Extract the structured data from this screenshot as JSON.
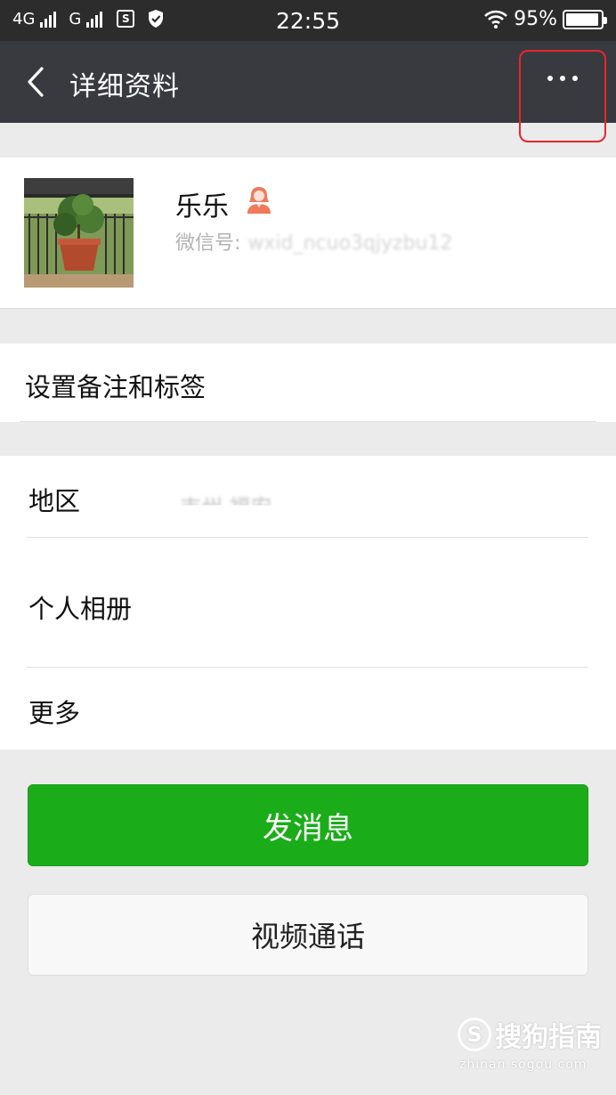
{
  "status_bar": {
    "network_1": "4G",
    "network_2": "G",
    "sim_icon_text": "S",
    "time": "22:55",
    "battery": "95%",
    "battery_level": 0.95
  },
  "nav": {
    "title": "详细资料",
    "back_icon": "chevron-left-icon",
    "more_icon": "ellipsis-icon"
  },
  "profile": {
    "name": "乐乐",
    "gender_icon": "female-user-icon",
    "wechat_id_label": "微信号:",
    "wechat_id_value": "wxid_ncuo3qjyzbu12"
  },
  "menu": {
    "remark_tags": "设置备注和标签",
    "region_label": "地区",
    "region_value": "吉州 福安",
    "album_label": "个人相册",
    "more_label": "更多"
  },
  "actions": {
    "send_message": "发消息",
    "video_call": "视频通话"
  },
  "watermark": {
    "logo_letter": "S",
    "brand": "搜狗指南",
    "url": "zhinan.sogou.com"
  },
  "colors": {
    "nav_bg": "#393a3f",
    "status_bg": "#2c2c2c",
    "primary_green": "#1aad19",
    "highlight_red": "#e8262b",
    "page_bg": "#ebebeb"
  }
}
